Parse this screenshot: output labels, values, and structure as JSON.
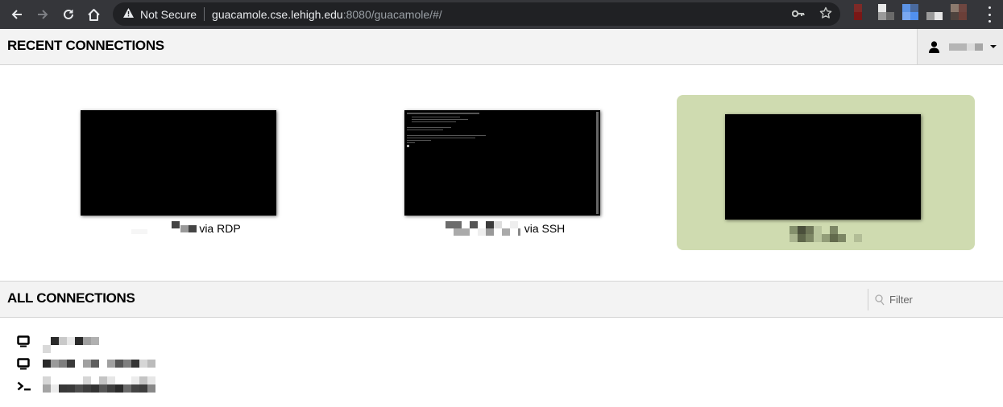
{
  "browser": {
    "back_icon": "arrow-left-icon",
    "forward_icon": "arrow-right-icon",
    "reload_icon": "reload-icon",
    "home_icon": "home-icon",
    "security_label": "Not Secure",
    "url_host": "guacamole.cse.lehigh.edu",
    "url_rest": ":8080/guacamole/#/",
    "key_icon": "key-icon",
    "star_icon": "star-icon",
    "menu_icon": "kebab-menu-icon",
    "extension_count": 5
  },
  "header": {
    "title": "RECENT CONNECTIONS",
    "user_icon": "user-icon",
    "user_name_redacted": true
  },
  "recent_connections": [
    {
      "protocol_label": "via RDP",
      "name_redacted": true,
      "thumbnail": "blank-desktop",
      "active": false
    },
    {
      "protocol_label": "via SSH",
      "name_redacted": true,
      "thumbnail": "terminal-output",
      "active": false
    },
    {
      "protocol_label": "",
      "name_redacted": true,
      "thumbnail": "blank-desktop",
      "active": true
    }
  ],
  "all_connections": {
    "title": "ALL CONNECTIONS",
    "filter_placeholder": "Filter",
    "filter_value": "",
    "items": [
      {
        "type": "desktop",
        "icon": "monitor-icon",
        "name_redacted": true
      },
      {
        "type": "desktop",
        "icon": "monitor-icon",
        "name_redacted": true
      },
      {
        "type": "terminal",
        "icon": "terminal-icon",
        "name_redacted": true
      }
    ]
  },
  "colors": {
    "active_tile": "#cfdbb0",
    "header_bg": "#f3f3f3",
    "chrome_bg": "#35363a",
    "omnibox_bg": "#202124"
  }
}
